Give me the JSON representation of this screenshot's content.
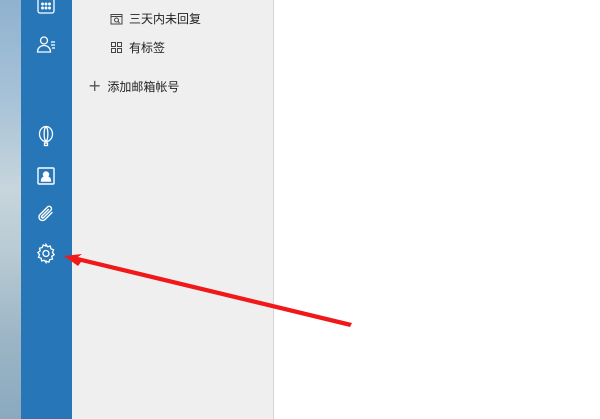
{
  "folder_pane": {
    "items": [
      {
        "label": "三天内未回复",
        "icon": "calendar-folder-icon"
      },
      {
        "label": "有标签",
        "icon": "tag-grid-icon"
      }
    ],
    "add_account_label": "添加邮箱帐号"
  },
  "icon_rail": {
    "icons": [
      "calendar-grid-icon",
      "contacts-icon",
      "balloon-icon",
      "contact-card-icon",
      "attachment-icon",
      "settings-gear-icon"
    ]
  },
  "annotation": {
    "arrow_color": "#f01818"
  },
  "colors": {
    "rail": "#2777b8",
    "pane": "#efefef"
  }
}
